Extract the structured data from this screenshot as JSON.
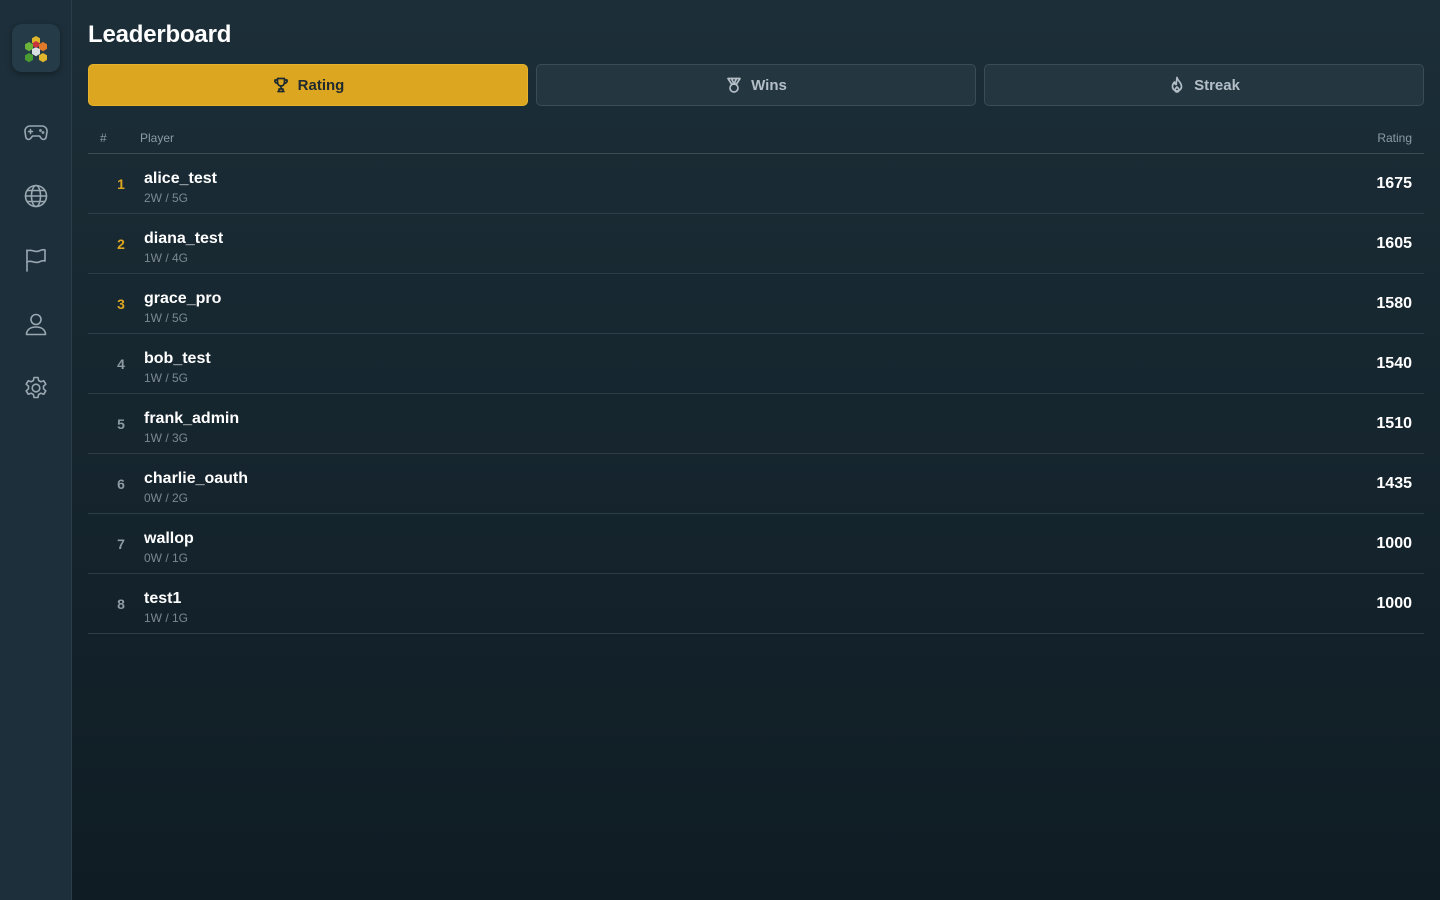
{
  "app": {
    "logo_icon": "hex-cluster-logo-icon"
  },
  "sidebar": {
    "items": [
      {
        "icon": "gamepad-icon",
        "label": ""
      },
      {
        "icon": "globe-icon",
        "label": ""
      },
      {
        "icon": "flag-icon",
        "label": ""
      },
      {
        "icon": "user-icon",
        "label": ""
      },
      {
        "icon": "gear-icon",
        "label": ""
      }
    ]
  },
  "page": {
    "title": "Leaderboard"
  },
  "tabs": [
    {
      "label": "Rating",
      "icon": "trophy-icon",
      "active": true
    },
    {
      "label": "Wins",
      "icon": "medal-icon",
      "active": false
    },
    {
      "label": "Streak",
      "icon": "flame-icon",
      "active": false
    }
  ],
  "table": {
    "columns": {
      "rank": "#",
      "player": "Player",
      "rating": "Rating"
    },
    "rows": [
      {
        "rank": "1",
        "name": "alice_test",
        "record": "2W / 5G",
        "rating": "1675"
      },
      {
        "rank": "2",
        "name": "diana_test",
        "record": "1W / 4G",
        "rating": "1605"
      },
      {
        "rank": "3",
        "name": "grace_pro",
        "record": "1W / 5G",
        "rating": "1580"
      },
      {
        "rank": "4",
        "name": "bob_test",
        "record": "1W / 5G",
        "rating": "1540"
      },
      {
        "rank": "5",
        "name": "frank_admin",
        "record": "1W / 3G",
        "rating": "1510"
      },
      {
        "rank": "6",
        "name": "charlie_oauth",
        "record": "0W / 2G",
        "rating": "1435"
      },
      {
        "rank": "7",
        "name": "wallop",
        "record": "0W / 1G",
        "rating": "1000"
      },
      {
        "rank": "8",
        "name": "test1",
        "record": "1W / 1G",
        "rating": "1000"
      }
    ]
  },
  "colors": {
    "accent": "#dca620",
    "background_top": "#1c2e38",
    "background_bottom": "#0f1c24",
    "sidebar": "#1d2f3a"
  }
}
